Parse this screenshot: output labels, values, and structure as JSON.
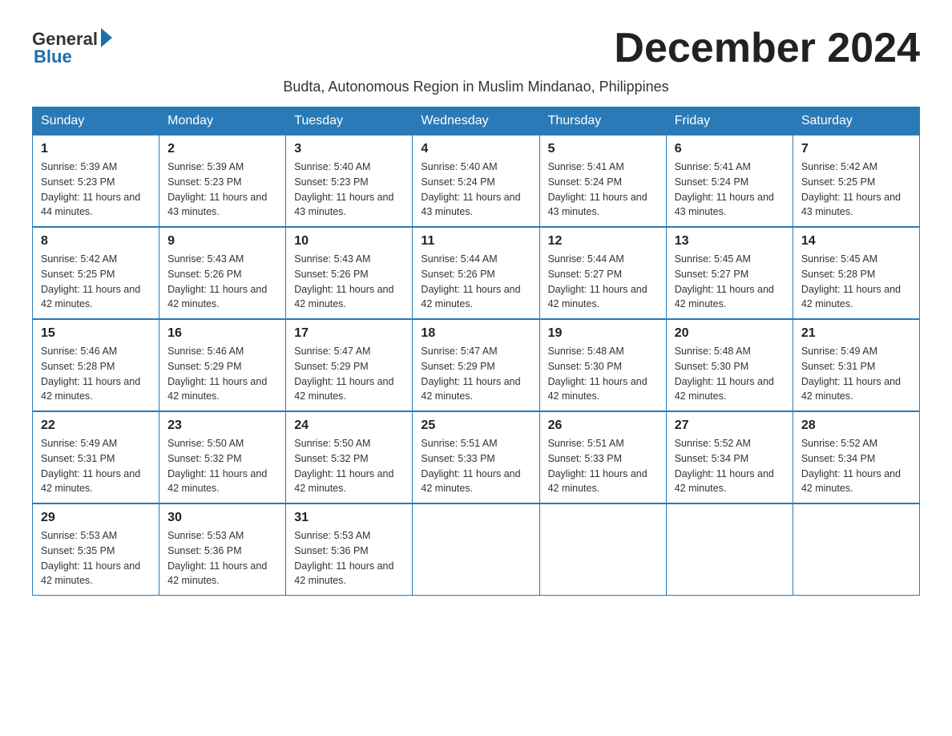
{
  "logo": {
    "general": "General",
    "blue": "Blue"
  },
  "title": "December 2024",
  "subtitle": "Budta, Autonomous Region in Muslim Mindanao, Philippines",
  "days_of_week": [
    "Sunday",
    "Monday",
    "Tuesday",
    "Wednesday",
    "Thursday",
    "Friday",
    "Saturday"
  ],
  "weeks": [
    [
      {
        "day": "1",
        "sunrise": "5:39 AM",
        "sunset": "5:23 PM",
        "daylight": "11 hours and 44 minutes."
      },
      {
        "day": "2",
        "sunrise": "5:39 AM",
        "sunset": "5:23 PM",
        "daylight": "11 hours and 43 minutes."
      },
      {
        "day": "3",
        "sunrise": "5:40 AM",
        "sunset": "5:23 PM",
        "daylight": "11 hours and 43 minutes."
      },
      {
        "day": "4",
        "sunrise": "5:40 AM",
        "sunset": "5:24 PM",
        "daylight": "11 hours and 43 minutes."
      },
      {
        "day": "5",
        "sunrise": "5:41 AM",
        "sunset": "5:24 PM",
        "daylight": "11 hours and 43 minutes."
      },
      {
        "day": "6",
        "sunrise": "5:41 AM",
        "sunset": "5:24 PM",
        "daylight": "11 hours and 43 minutes."
      },
      {
        "day": "7",
        "sunrise": "5:42 AM",
        "sunset": "5:25 PM",
        "daylight": "11 hours and 43 minutes."
      }
    ],
    [
      {
        "day": "8",
        "sunrise": "5:42 AM",
        "sunset": "5:25 PM",
        "daylight": "11 hours and 42 minutes."
      },
      {
        "day": "9",
        "sunrise": "5:43 AM",
        "sunset": "5:26 PM",
        "daylight": "11 hours and 42 minutes."
      },
      {
        "day": "10",
        "sunrise": "5:43 AM",
        "sunset": "5:26 PM",
        "daylight": "11 hours and 42 minutes."
      },
      {
        "day": "11",
        "sunrise": "5:44 AM",
        "sunset": "5:26 PM",
        "daylight": "11 hours and 42 minutes."
      },
      {
        "day": "12",
        "sunrise": "5:44 AM",
        "sunset": "5:27 PM",
        "daylight": "11 hours and 42 minutes."
      },
      {
        "day": "13",
        "sunrise": "5:45 AM",
        "sunset": "5:27 PM",
        "daylight": "11 hours and 42 minutes."
      },
      {
        "day": "14",
        "sunrise": "5:45 AM",
        "sunset": "5:28 PM",
        "daylight": "11 hours and 42 minutes."
      }
    ],
    [
      {
        "day": "15",
        "sunrise": "5:46 AM",
        "sunset": "5:28 PM",
        "daylight": "11 hours and 42 minutes."
      },
      {
        "day": "16",
        "sunrise": "5:46 AM",
        "sunset": "5:29 PM",
        "daylight": "11 hours and 42 minutes."
      },
      {
        "day": "17",
        "sunrise": "5:47 AM",
        "sunset": "5:29 PM",
        "daylight": "11 hours and 42 minutes."
      },
      {
        "day": "18",
        "sunrise": "5:47 AM",
        "sunset": "5:29 PM",
        "daylight": "11 hours and 42 minutes."
      },
      {
        "day": "19",
        "sunrise": "5:48 AM",
        "sunset": "5:30 PM",
        "daylight": "11 hours and 42 minutes."
      },
      {
        "day": "20",
        "sunrise": "5:48 AM",
        "sunset": "5:30 PM",
        "daylight": "11 hours and 42 minutes."
      },
      {
        "day": "21",
        "sunrise": "5:49 AM",
        "sunset": "5:31 PM",
        "daylight": "11 hours and 42 minutes."
      }
    ],
    [
      {
        "day": "22",
        "sunrise": "5:49 AM",
        "sunset": "5:31 PM",
        "daylight": "11 hours and 42 minutes."
      },
      {
        "day": "23",
        "sunrise": "5:50 AM",
        "sunset": "5:32 PM",
        "daylight": "11 hours and 42 minutes."
      },
      {
        "day": "24",
        "sunrise": "5:50 AM",
        "sunset": "5:32 PM",
        "daylight": "11 hours and 42 minutes."
      },
      {
        "day": "25",
        "sunrise": "5:51 AM",
        "sunset": "5:33 PM",
        "daylight": "11 hours and 42 minutes."
      },
      {
        "day": "26",
        "sunrise": "5:51 AM",
        "sunset": "5:33 PM",
        "daylight": "11 hours and 42 minutes."
      },
      {
        "day": "27",
        "sunrise": "5:52 AM",
        "sunset": "5:34 PM",
        "daylight": "11 hours and 42 minutes."
      },
      {
        "day": "28",
        "sunrise": "5:52 AM",
        "sunset": "5:34 PM",
        "daylight": "11 hours and 42 minutes."
      }
    ],
    [
      {
        "day": "29",
        "sunrise": "5:53 AM",
        "sunset": "5:35 PM",
        "daylight": "11 hours and 42 minutes."
      },
      {
        "day": "30",
        "sunrise": "5:53 AM",
        "sunset": "5:36 PM",
        "daylight": "11 hours and 42 minutes."
      },
      {
        "day": "31",
        "sunrise": "5:53 AM",
        "sunset": "5:36 PM",
        "daylight": "11 hours and 42 minutes."
      },
      null,
      null,
      null,
      null
    ]
  ]
}
